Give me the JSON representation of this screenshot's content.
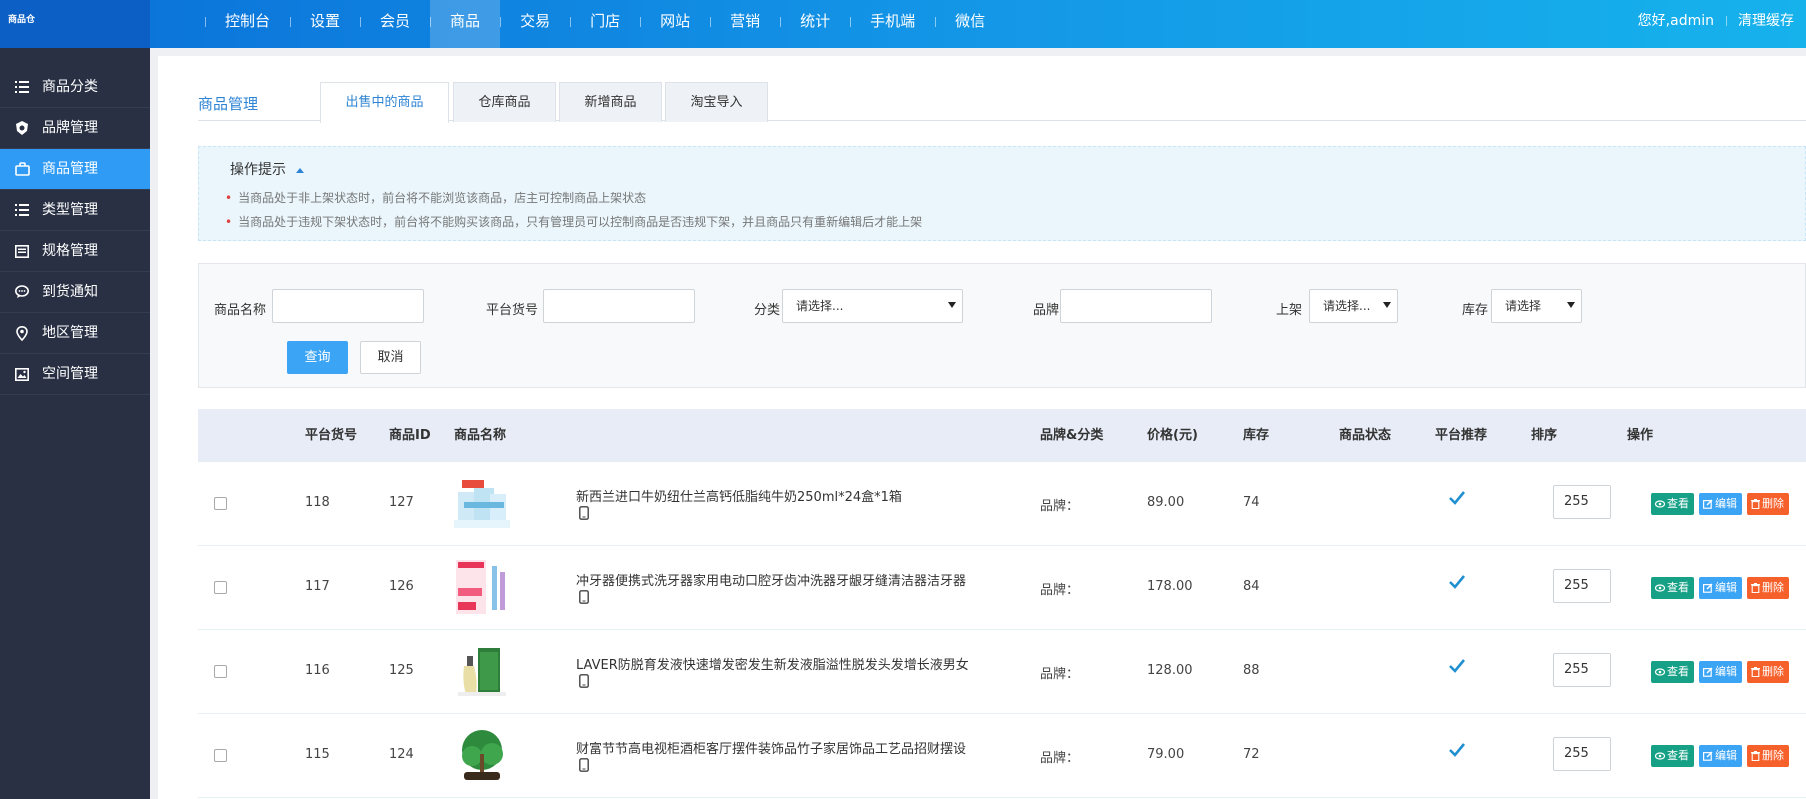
{
  "header": {
    "logo_text": "商品仓",
    "nav": [
      "控制台",
      "设置",
      "会员",
      "商品",
      "交易",
      "门店",
      "网站",
      "营销",
      "统计",
      "手机端",
      "微信"
    ],
    "active_index": 3,
    "greeting": "您好,admin",
    "clear_cache": "清理缓存"
  },
  "sidebar": {
    "items": [
      {
        "label": "商品分类",
        "icon": "list-icon"
      },
      {
        "label": "品牌管理",
        "icon": "shield-icon"
      },
      {
        "label": "商品管理",
        "icon": "bag-icon",
        "active": true
      },
      {
        "label": "类型管理",
        "icon": "list-icon"
      },
      {
        "label": "规格管理",
        "icon": "spec-icon"
      },
      {
        "label": "到货通知",
        "icon": "chat-icon"
      },
      {
        "label": "地区管理",
        "icon": "location-icon"
      },
      {
        "label": "空间管理",
        "icon": "image-icon"
      }
    ]
  },
  "page": {
    "title": "商品管理",
    "tabs": [
      "出售中的商品",
      "仓库商品",
      "新增商品",
      "淘宝导入"
    ],
    "active_tab": 0
  },
  "tips": {
    "title": "操作提示",
    "lines": [
      "当商品处于非上架状态时，前台将不能浏览该商品，店主可控制商品上架状态",
      "当商品处于违规下架状态时，前台将不能购买该商品，只有管理员可以控制商品是否违规下架，并且商品只有重新编辑后才能上架"
    ]
  },
  "search": {
    "name_label": "商品名称",
    "sku_label": "平台货号",
    "category_label": "分类",
    "category_value": "请选择...",
    "brand_label": "品牌",
    "shelf_label": "上架",
    "shelf_value": "请选择...",
    "stock_label": "库存",
    "stock_value": "请选择",
    "query_button": "查询",
    "cancel_button": "取消"
  },
  "table": {
    "headers": [
      "平台货号",
      "商品ID",
      "商品名称",
      "品牌&分类",
      "价格(元)",
      "库存",
      "商品状态",
      "平台推荐",
      "排序",
      "操作"
    ],
    "rows": [
      {
        "sku": "118",
        "id": "127",
        "name": "新西兰进口牛奶纽仕兰高钙低脂纯牛奶250ml*24盒*1箱",
        "brand": "品牌：",
        "price": "89.00",
        "stock": "74",
        "sort": "255"
      },
      {
        "sku": "117",
        "id": "126",
        "name": "冲牙器便携式洗牙器家用电动口腔牙齿冲洗器牙龈牙缝清洁器洁牙器",
        "brand": "品牌：",
        "price": "178.00",
        "stock": "84",
        "sort": "255"
      },
      {
        "sku": "116",
        "id": "125",
        "name": "LAVER防脱育发液快速增发密发生新发液脂溢性脱发头发增长液男女",
        "brand": "品牌：",
        "price": "128.00",
        "stock": "88",
        "sort": "255"
      },
      {
        "sku": "115",
        "id": "124",
        "name": "财富节节高电视柜酒柜客厅摆件装饰品竹子家居饰品工艺品招财摆设",
        "brand": "品牌：",
        "price": "79.00",
        "stock": "72",
        "sort": "255"
      }
    ],
    "actions": {
      "view": "查看",
      "edit": "编辑",
      "delete": "删除"
    }
  },
  "colors": {
    "sidebar_bg": "#293044",
    "accent": "#2f9bf5",
    "view_btn": "#16a085",
    "edit_btn": "#3ca4f5",
    "delete_btn": "#f5602b"
  }
}
